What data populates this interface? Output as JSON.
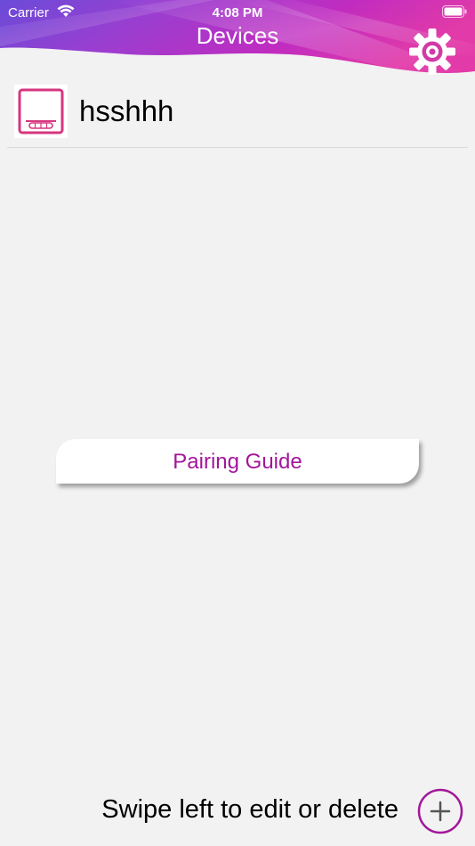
{
  "status_bar": {
    "carrier": "Carrier",
    "time": "4:08 PM",
    "icons": [
      "wifi-icon",
      "battery-icon"
    ]
  },
  "header": {
    "title": "Devices",
    "settings_icon": "gear-icon"
  },
  "devices": [
    {
      "name": "hsshhh",
      "icon": "device-icon"
    }
  ],
  "pairing_guide": {
    "label": "Pairing Guide"
  },
  "footer": {
    "hint": "Swipe left to edit or delete",
    "add_icon": "plus-icon"
  },
  "colors": {
    "accent": "#a2169a",
    "device_icon": "#d6357e",
    "background": "#f2f2f2",
    "header_gradient": [
      "#6a4bd8",
      "#c02cc0",
      "#e23aa8"
    ]
  }
}
